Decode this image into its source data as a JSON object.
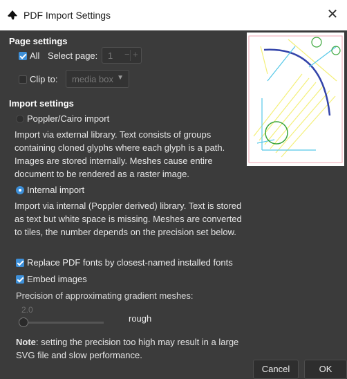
{
  "window": {
    "title": "PDF Import Settings",
    "close_glyph": "✕"
  },
  "page_settings": {
    "heading": "Page settings",
    "all_label": "All",
    "select_page_label": "Select page:",
    "page_value": "1",
    "minus": "−",
    "plus": "+",
    "clip_label": "Clip to:",
    "clip_value": "media box",
    "clip_arrow": "▼"
  },
  "import_settings": {
    "heading": "Import settings",
    "poppler_label": "Poppler/Cairo import",
    "poppler_desc": "Import via external library. Text consists of groups containing cloned glyphs where each glyph is a path. Images are stored internally. Meshes cause entire document to be rendered as a raster image.",
    "internal_label": "Internal import",
    "internal_desc": "Import via internal (Poppler derived) library. Text is stored as text but white space is missing. Meshes are converted to tiles, the number depends on the precision set below.",
    "replace_fonts_label": "Replace PDF fonts by closest-named installed fonts",
    "embed_images_label": "Embed images",
    "precision_label": "Precision of approximating gradient meshes:",
    "precision_value": "2.0",
    "precision_word": "rough",
    "note_bold": "Note",
    "note_text": ": setting the precision too high may result in a large SVG file and slow performance."
  },
  "buttons": {
    "cancel": "Cancel",
    "ok": "OK"
  },
  "icons": {
    "app": "inkscape-icon",
    "close": "close-icon"
  },
  "colors": {
    "accent": "#3d8fd8",
    "background": "#3b3b3b",
    "titlebar": "#ffffff"
  }
}
